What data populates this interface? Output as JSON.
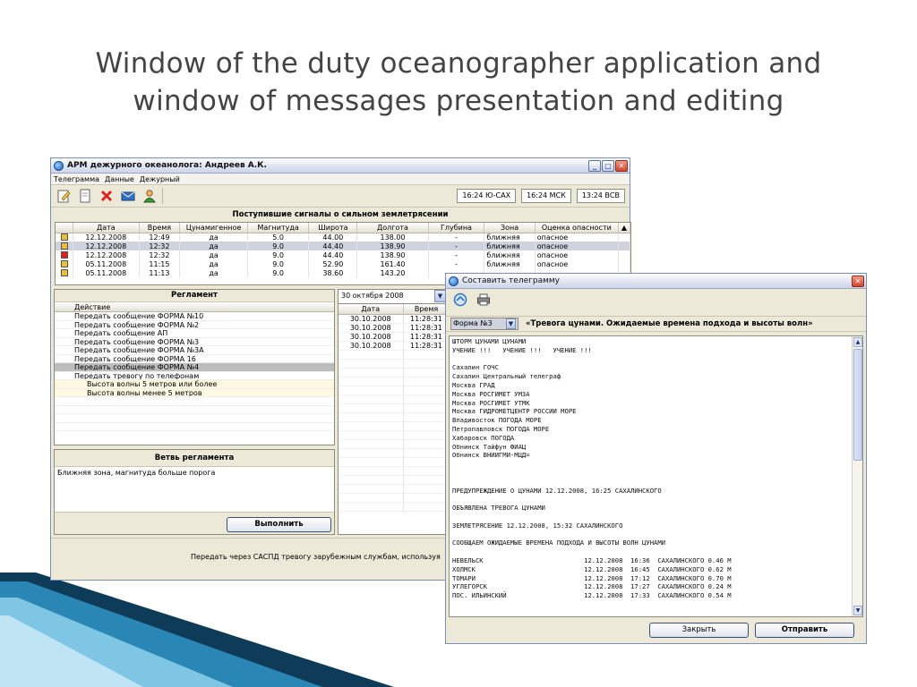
{
  "slide": {
    "title_line1": "Window of the duty oceanographer application and",
    "title_line2": "window of messages presentation and editing"
  },
  "main_window": {
    "title": "АРМ дежурного океанолога:  Андреев А.К.",
    "menu": [
      "Телеграмма",
      "Данные",
      "Дежурный"
    ],
    "clocks": [
      "16:24 Ю-САХ",
      "16:24 МСК",
      "13:24 ВСВ"
    ],
    "signals": {
      "heading": "Поступившие сигналы о сильном землетрясении",
      "columns": [
        "",
        "Дата",
        "Время",
        "Цунамигенное",
        "Магнитуда",
        "Широта",
        "Долгота",
        "Глубина",
        "Зона",
        "Оценка опасности"
      ],
      "rows": [
        {
          "marker_color": "#e8c13a",
          "date": "12.12.2008",
          "time": "12:49",
          "tsunami": "да",
          "magnitude": "5.0",
          "lat": "44.00",
          "lon": "138.00",
          "depth": "-",
          "zone": "ближняя",
          "danger": "опасное"
        },
        {
          "marker_color": "#e8c13a",
          "date": "12.12.2008",
          "time": "12:32",
          "tsunami": "да",
          "magnitude": "9.0",
          "lat": "44.40",
          "lon": "138.90",
          "depth": "-",
          "zone": "ближняя",
          "danger": "опасное"
        },
        {
          "marker_color": "#e02020",
          "date": "12.12.2008",
          "time": "12:32",
          "tsunami": "да",
          "magnitude": "9.0",
          "lat": "44.40",
          "lon": "138.90",
          "depth": "-",
          "zone": "ближняя",
          "danger": "опасное"
        },
        {
          "marker_color": "#e8c13a",
          "date": "05.11.2008",
          "time": "11:15",
          "tsunami": "да",
          "magnitude": "9.0",
          "lat": "52.90",
          "lon": "161.40",
          "depth": "-",
          "zone": "ближняя",
          "danger": "опасное"
        },
        {
          "marker_color": "#e8c13a",
          "date": "05.11.2008",
          "time": "11:13",
          "tsunami": "да",
          "magnitude": "9.0",
          "lat": "38.60",
          "lon": "143.20",
          "depth": "",
          "zone": "",
          "danger": ""
        }
      ]
    },
    "regulation": {
      "heading": "Регламент",
      "column": "Действие",
      "items": [
        {
          "label": "Передать сообщение ФОРМА №10",
          "kind": "normal"
        },
        {
          "label": "Передать сообщение ФОРМА №2",
          "kind": "normal"
        },
        {
          "label": "Передать сообщение АП",
          "kind": "normal"
        },
        {
          "label": "Передать сообщение ФОРМА №3",
          "kind": "normal"
        },
        {
          "label": "Передать сообщение ФОРМА №3А",
          "kind": "normal"
        },
        {
          "label": "Передать сообщение ФОРМА 16",
          "kind": "normal"
        },
        {
          "label": "Передать сообщение ФОРМА №4",
          "kind": "selected"
        },
        {
          "label": "Передать тревогу по телефонам",
          "kind": "normal"
        },
        {
          "label": "Высота волны 5 метров или более",
          "kind": "sub"
        },
        {
          "label": "Высота волны менее 5 метров",
          "kind": "sub"
        }
      ]
    },
    "branch": {
      "heading": "Ветвь регламента",
      "text": "Ближняя зона, магнитуда больше порога",
      "execute_label": "Выполнить"
    },
    "date_list": {
      "selected_date": "30 октября 2008",
      "columns": [
        "Дата",
        "Время"
      ],
      "rows": [
        {
          "date": "30.10.2008",
          "time": "11:28:31"
        },
        {
          "date": "30.10.2008",
          "time": "11:28:31"
        },
        {
          "date": "30.10.2008",
          "time": "11:28:31"
        },
        {
          "date": "30.10.2008",
          "time": "11:28:31"
        }
      ]
    },
    "bottom_message": "Передать через САСПД тревогу зарубежным службам, используя"
  },
  "telegram_window": {
    "title": "Составить телеграмму",
    "form_select": "Форма №3",
    "form_title": "«Тревога цунами. Ожидаемые времена подхода и высоты волн»",
    "lines": [
      "ШТОРМ ЦУНАМИ ЦУНАМИ",
      "УЧЕНИЕ !!!   УЧЕНИЕ !!!   УЧЕНИЕ !!!",
      "",
      "Сахалин ГОЧС",
      "Сахалин Центральный телеграф",
      "Москва ГРАД",
      "Москва РОСГИМЕТ УМЗА",
      "Москва РОСГИМЕТ УТМК",
      "Москва ГИДРОМЕТЦЕНТР РОССИИ МОРЕ",
      "Владивосток ПОГОДА МОРЕ",
      "Петропавловск ПОГОДА МОРЕ",
      "Хабаровск ПОГОДА",
      "Обнинск Тайфун ФИАЦ",
      "Обнинск ВНИИГМИ-МЦД=",
      "",
      "",
      "",
      "ПРЕДУПРЕЖДЕНИЕ О ЦУНАМИ 12.12.2008, 16:25 САХАЛИНСКОГО",
      "",
      "ОБЪЯВЛЕНА ТРЕВОГА ЦУНАМИ",
      "",
      "ЗЕМЛЕТРЯСЕНИЕ 12.12.2008, 15:32 САХАЛИНСКОГО",
      "",
      "СООБЩАЕМ ОЖИДАЕМЫЕ ВРЕМЕНА ПОДХОДА И ВЫСОТЫ ВОЛН ЦУНАМИ",
      "",
      "НЕВЕЛЬСК                          12.12.2008  16:36  САХАЛИНСКОГО 0.46 М",
      "ХОЛМСК                            12.12.2008  16:45  САХАЛИНСКОГО 0.62 М",
      "ТОМАРИ                            12.12.2008  17:12  САХАЛИНСКОГО 0.70 М",
      "УГЛЕГОРСК                         12.12.2008  17:27  САХАЛИНСКОГО 0.24 М",
      "ПОС. ИЛЬИНСКИЙ                    12.12.2008  17:33  САХАЛИНСКОГО 0.54 М"
    ],
    "close_label": "Закрыть",
    "send_label": "Отправить"
  },
  "icons": {
    "app": "globe-icon",
    "toolbar": [
      "edit-icon",
      "document-icon",
      "delete-icon",
      "mail-icon",
      "user-icon"
    ],
    "telegram_toolbar": [
      "open-icon",
      "print-icon"
    ]
  }
}
